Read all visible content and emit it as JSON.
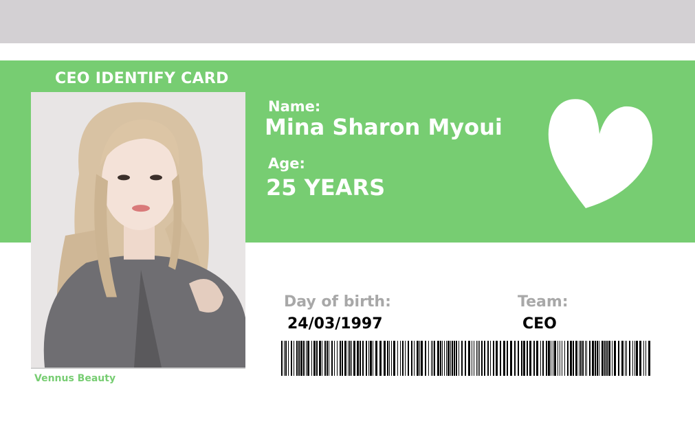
{
  "colors": {
    "green": "#77cd72",
    "grey": "#d3d0d3",
    "white": "#ffffff"
  },
  "card": {
    "title": "CEO IDENTIFY CARD",
    "brand": "Vennus Beauty"
  },
  "fields": {
    "name_label": "Name:",
    "name_value": "Mina Sharon Myoui",
    "age_label": "Age:",
    "age_value": "25 YEARS",
    "dob_label": "Day of birth:",
    "dob_value": "24/03/1997",
    "team_label": "Team:",
    "team_value": "CEO"
  },
  "icons": {
    "decor": "heart-icon",
    "photo": "portrait-photo",
    "code": "barcode"
  }
}
